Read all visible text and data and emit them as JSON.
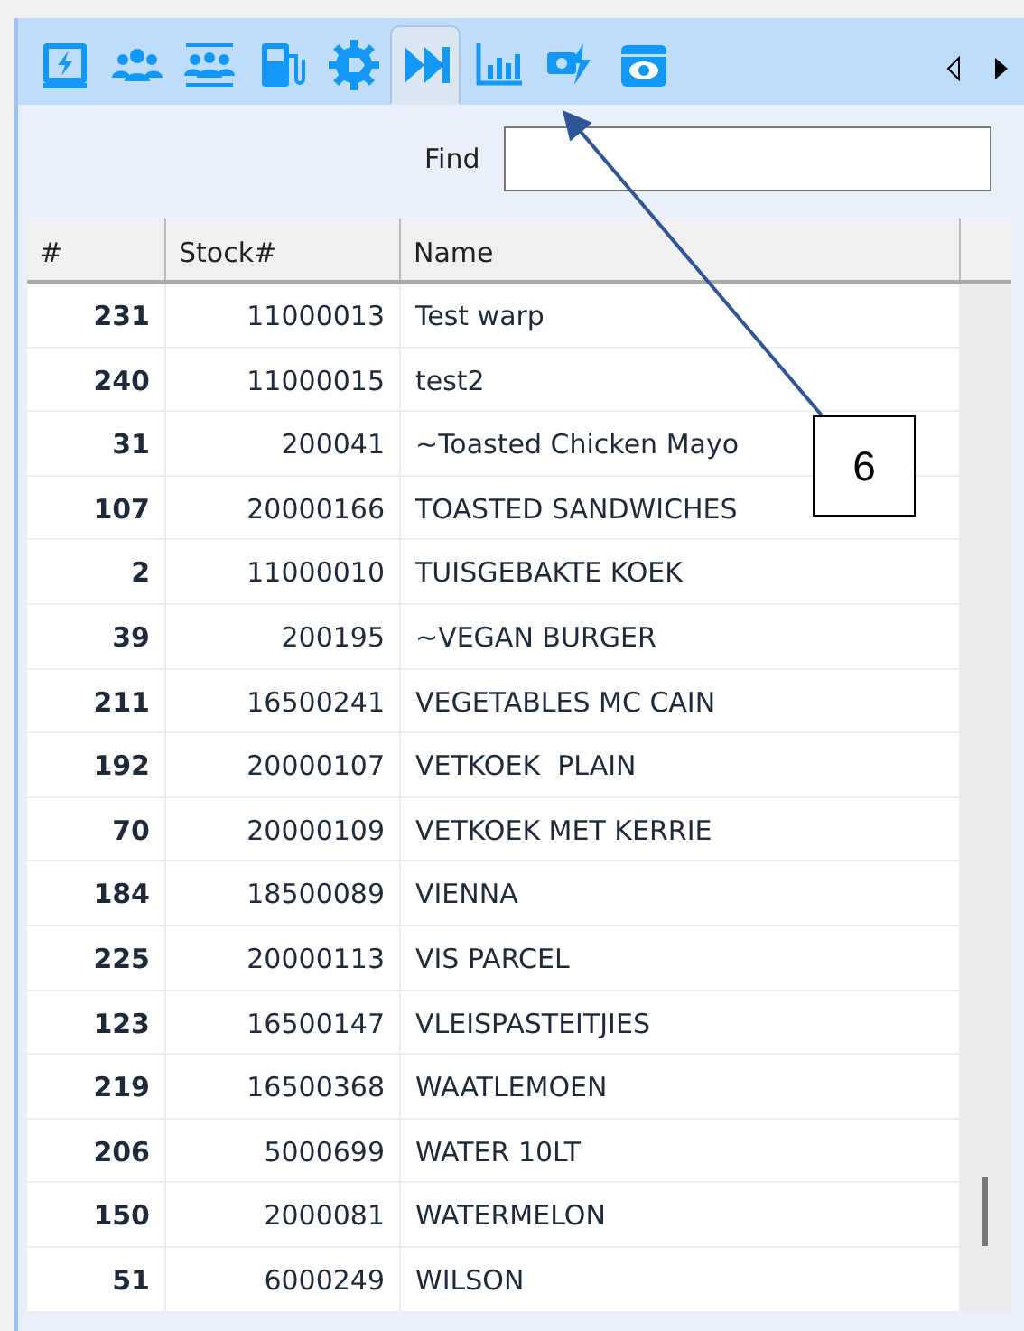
{
  "tabs": [
    {
      "selected": false
    },
    {
      "selected": false
    },
    {
      "selected": false
    },
    {
      "selected": false
    },
    {
      "selected": false
    },
    {
      "selected": true
    },
    {
      "selected": false
    },
    {
      "selected": false
    },
    {
      "selected": false
    }
  ],
  "find": {
    "label": "Find"
  },
  "table": {
    "columns": [
      "#",
      "Stock#",
      "Name"
    ],
    "rows": [
      {
        "num": "231",
        "stock": "11000013",
        "name": "Test warp"
      },
      {
        "num": "240",
        "stock": "11000015",
        "name": "test2"
      },
      {
        "num": "31",
        "stock": "200041",
        "name": "~Toasted Chicken Mayo"
      },
      {
        "num": "107",
        "stock": "20000166",
        "name": "TOASTED SANDWICHES"
      },
      {
        "num": "2",
        "stock": "11000010",
        "name": "TUISGEBAKTE KOEK"
      },
      {
        "num": "39",
        "stock": "200195",
        "name": "~VEGAN BURGER"
      },
      {
        "num": "211",
        "stock": "16500241",
        "name": "VEGETABLES MC CAIN"
      },
      {
        "num": "192",
        "stock": "20000107",
        "name": "VETKOEK  PLAIN"
      },
      {
        "num": "70",
        "stock": "20000109",
        "name": "VETKOEK MET KERRIE"
      },
      {
        "num": "184",
        "stock": "18500089",
        "name": "VIENNA"
      },
      {
        "num": "225",
        "stock": "20000113",
        "name": "VIS PARCEL"
      },
      {
        "num": "123",
        "stock": "16500147",
        "name": "VLEISPASTEITJIES"
      },
      {
        "num": "219",
        "stock": "16500368",
        "name": "WAATLEMOEN"
      },
      {
        "num": "206",
        "stock": "5000699",
        "name": "WATER 10LT"
      },
      {
        "num": "150",
        "stock": "2000081",
        "name": "WATERMELON"
      },
      {
        "num": "51",
        "stock": "6000249",
        "name": "WILSON"
      }
    ]
  },
  "callout": {
    "label": "6"
  }
}
